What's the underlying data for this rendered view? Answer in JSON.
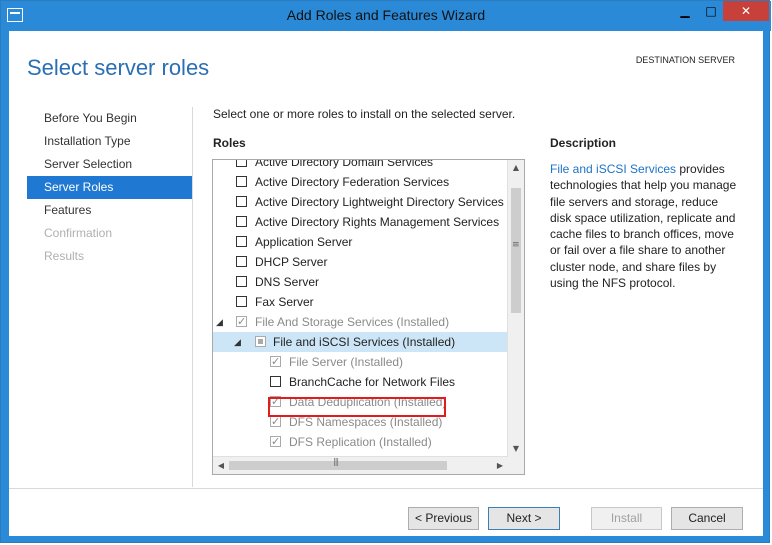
{
  "window": {
    "title": "Add Roles and Features Wizard",
    "min_glyph": "▁",
    "max_glyph": "□",
    "close_glyph": "✕"
  },
  "header": {
    "page_title": "Select server roles",
    "destination_label": "DESTINATION SERVER"
  },
  "nav": {
    "items": [
      {
        "label": "Before You Begin",
        "state": "normal"
      },
      {
        "label": "Installation Type",
        "state": "normal"
      },
      {
        "label": "Server Selection",
        "state": "normal"
      },
      {
        "label": "Server Roles",
        "state": "active"
      },
      {
        "label": "Features",
        "state": "normal"
      },
      {
        "label": "Confirmation",
        "state": "disabled"
      },
      {
        "label": "Results",
        "state": "disabled"
      }
    ]
  },
  "main": {
    "instruction": "Select one or more roles to install on the selected server.",
    "roles_heading": "Roles",
    "roles": [
      {
        "label": "Active Directory Domain Services",
        "checked": false
      },
      {
        "label": "Active Directory Federation Services",
        "checked": false
      },
      {
        "label": "Active Directory Lightweight Directory Services",
        "checked": false
      },
      {
        "label": "Active Directory Rights Management Services",
        "checked": false
      },
      {
        "label": "Application Server",
        "checked": false
      },
      {
        "label": "DHCP Server",
        "checked": false
      },
      {
        "label": "DNS Server",
        "checked": false
      },
      {
        "label": "Fax Server",
        "checked": false
      },
      {
        "label": "File And Storage Services (Installed)",
        "checked": true,
        "expander": "◢"
      },
      {
        "label": "File and iSCSI Services (Installed)",
        "checked": "partial",
        "expander": "◢",
        "selected": true
      },
      {
        "label": "File Server (Installed)",
        "checked": true
      },
      {
        "label": "BranchCache for Network Files",
        "checked": false
      },
      {
        "label": "Data Deduplication (Installed)",
        "checked": true
      },
      {
        "label": "DFS Namespaces (Installed)",
        "checked": true
      },
      {
        "label": "DFS Replication (Installed)",
        "checked": true
      }
    ]
  },
  "description": {
    "heading": "Description",
    "link_text": "File and iSCSI Services",
    "text": " provides technologies that help you manage file servers and storage, reduce disk space utilization, replicate and cache files to branch offices, move or fail over a file share to another cluster node, and share files by using the NFS protocol."
  },
  "footer": {
    "previous": "< Previous",
    "next": "Next >",
    "install": "Install",
    "cancel": "Cancel"
  },
  "colors": {
    "accent": "#1f78d1",
    "title_text": "#2a6eb4",
    "highlight_box": "#e21b1b",
    "link": "#1e72c8"
  }
}
